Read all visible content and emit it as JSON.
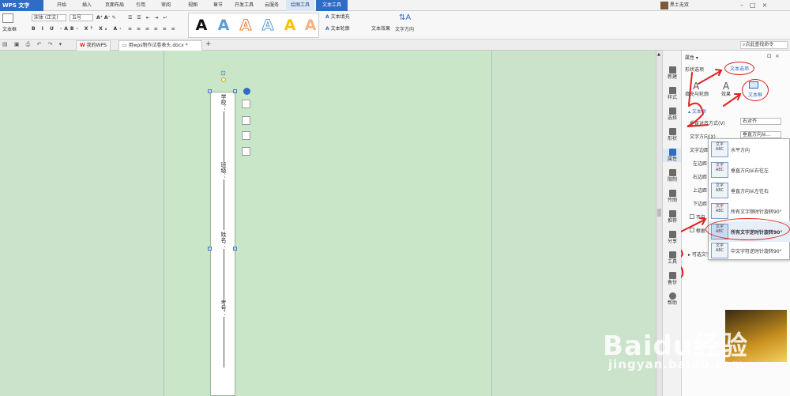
{
  "menu": {
    "app_button": "WPS 文字",
    "tabs": [
      "开始",
      "插入",
      "页面布局",
      "引用",
      "审阅",
      "视图",
      "章节",
      "开发工具",
      "云服务",
      "绘图工具",
      "文本工具"
    ],
    "user": "黑土无双"
  },
  "ribbon": {
    "textbox_label": "文本框",
    "font_name": "宋体 (正文)",
    "font_size": "五号",
    "text_fill": "文本填充",
    "text_outline": "文本轮廓",
    "text_effect": "文本效果",
    "text_direction": "文字方向",
    "bigA": "A"
  },
  "doctabs": {
    "mywps": "我的WPS",
    "doc": "用wps制作试卷表头.docx *",
    "add": "+",
    "search": "点此查找命令"
  },
  "textbox": {
    "labels": [
      "学校：",
      "班级：",
      "姓名：",
      "考号："
    ]
  },
  "sidebar": {
    "items": [
      "新建",
      "样式",
      "选择",
      "形状",
      "属性",
      "限制",
      "传图",
      "推荐",
      "分享",
      "工具",
      "备份",
      "帮助"
    ]
  },
  "panel": {
    "title": "属性",
    "tab_shape": "形状选项",
    "tab_text": "文本选项",
    "sub_fill": "填充与轮廓",
    "sub_effect": "效果",
    "sub_textbox": "文本框",
    "section": "文本框",
    "row_vertical_align": "垂直对齐方式(V)",
    "val_vertical_align": "右对齐",
    "row_text_dir": "文字方向(X)",
    "val_text_dir": "垂直方向从...",
    "rows": [
      "文字边距",
      "左边距",
      "右边距",
      "上边距",
      "下边距"
    ],
    "check1": "不自",
    "check2": "根据",
    "link": "可选文字"
  },
  "dropdown": {
    "items": [
      {
        "label": "水平方向",
        "icon": "文字ABC"
      },
      {
        "label": "垂直方向从右往左",
        "icon": "文字ABC"
      },
      {
        "label": "垂直方向从左往右",
        "icon": "文字ABC"
      },
      {
        "label": "所有文字顺时针旋转90°",
        "icon": "文字ABC"
      },
      {
        "label": "所有文字逆时针旋转90°",
        "icon": "文字ABC"
      },
      {
        "label": "中文字符逆时针旋转90°",
        "icon": "文字ABC"
      }
    ]
  },
  "annotations": [
    "1",
    "2",
    "3"
  ],
  "watermark": {
    "brand": "Baidu经验",
    "url": "jingyan.baidu.com"
  },
  "colors": {
    "accent": "#2f6cc4",
    "annotation": "#e02020",
    "doc_bg": "#c9e6c9"
  }
}
